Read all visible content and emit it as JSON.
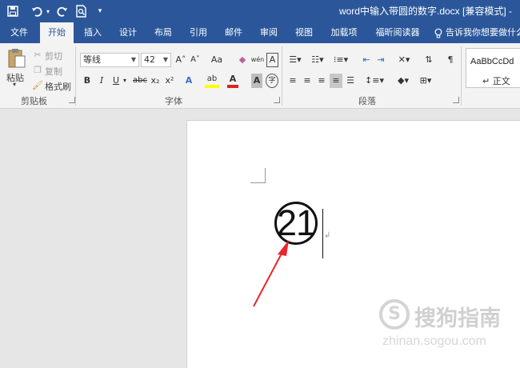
{
  "titlebar": {
    "title": "word中输入带圆的数字.docx [兼容模式]  -",
    "qat": {
      "save_icon": "save-icon",
      "undo_icon": "undo-icon",
      "redo_icon": "redo-icon",
      "print_preview_icon": "print-preview-icon",
      "customize_icon": "customize-qat-icon"
    }
  },
  "tabs": [
    {
      "label": "文件"
    },
    {
      "label": "开始",
      "active": true
    },
    {
      "label": "插入"
    },
    {
      "label": "设计"
    },
    {
      "label": "布局"
    },
    {
      "label": "引用"
    },
    {
      "label": "邮件"
    },
    {
      "label": "审阅"
    },
    {
      "label": "视图"
    },
    {
      "label": "加载项"
    },
    {
      "label": "福昕阅读器"
    }
  ],
  "tell_me": {
    "placeholder": "告诉我你想要做什么"
  },
  "ribbon": {
    "clipboard": {
      "label": "剪贴板",
      "paste_label": "粘贴",
      "cut_label": "剪切",
      "copy_label": "复制",
      "format_painter_label": "格式刷"
    },
    "font": {
      "label": "字体",
      "font_name": "等线",
      "font_size": "42",
      "grow_font": "A˄",
      "shrink_font": "A˅",
      "change_case": "Aa",
      "clear_format_icon": "eraser-icon",
      "phonetic_guide": "wén",
      "char_border": "A",
      "bold": "B",
      "italic": "I",
      "underline": "U",
      "strikethrough": "abc",
      "subscript": "x₂",
      "superscript": "x²",
      "text_effects": "A",
      "highlight": "ab",
      "font_color": "A",
      "char_shading": "A",
      "enclose_char": "字",
      "font_color_hex": "#e02020",
      "highlight_hex": "#ffff00"
    },
    "paragraph": {
      "label": "段落"
    },
    "styles": {
      "preview": "AaBbCcDd",
      "name": "↵ 正文"
    }
  },
  "document": {
    "enclosed_number": "21"
  },
  "watermark": {
    "text": "搜狗指南",
    "url": "zhinan.sogou.com",
    "icon_glyph": "S"
  },
  "colors": {
    "accent": "#2b579a",
    "arrow": "#e8262c"
  }
}
